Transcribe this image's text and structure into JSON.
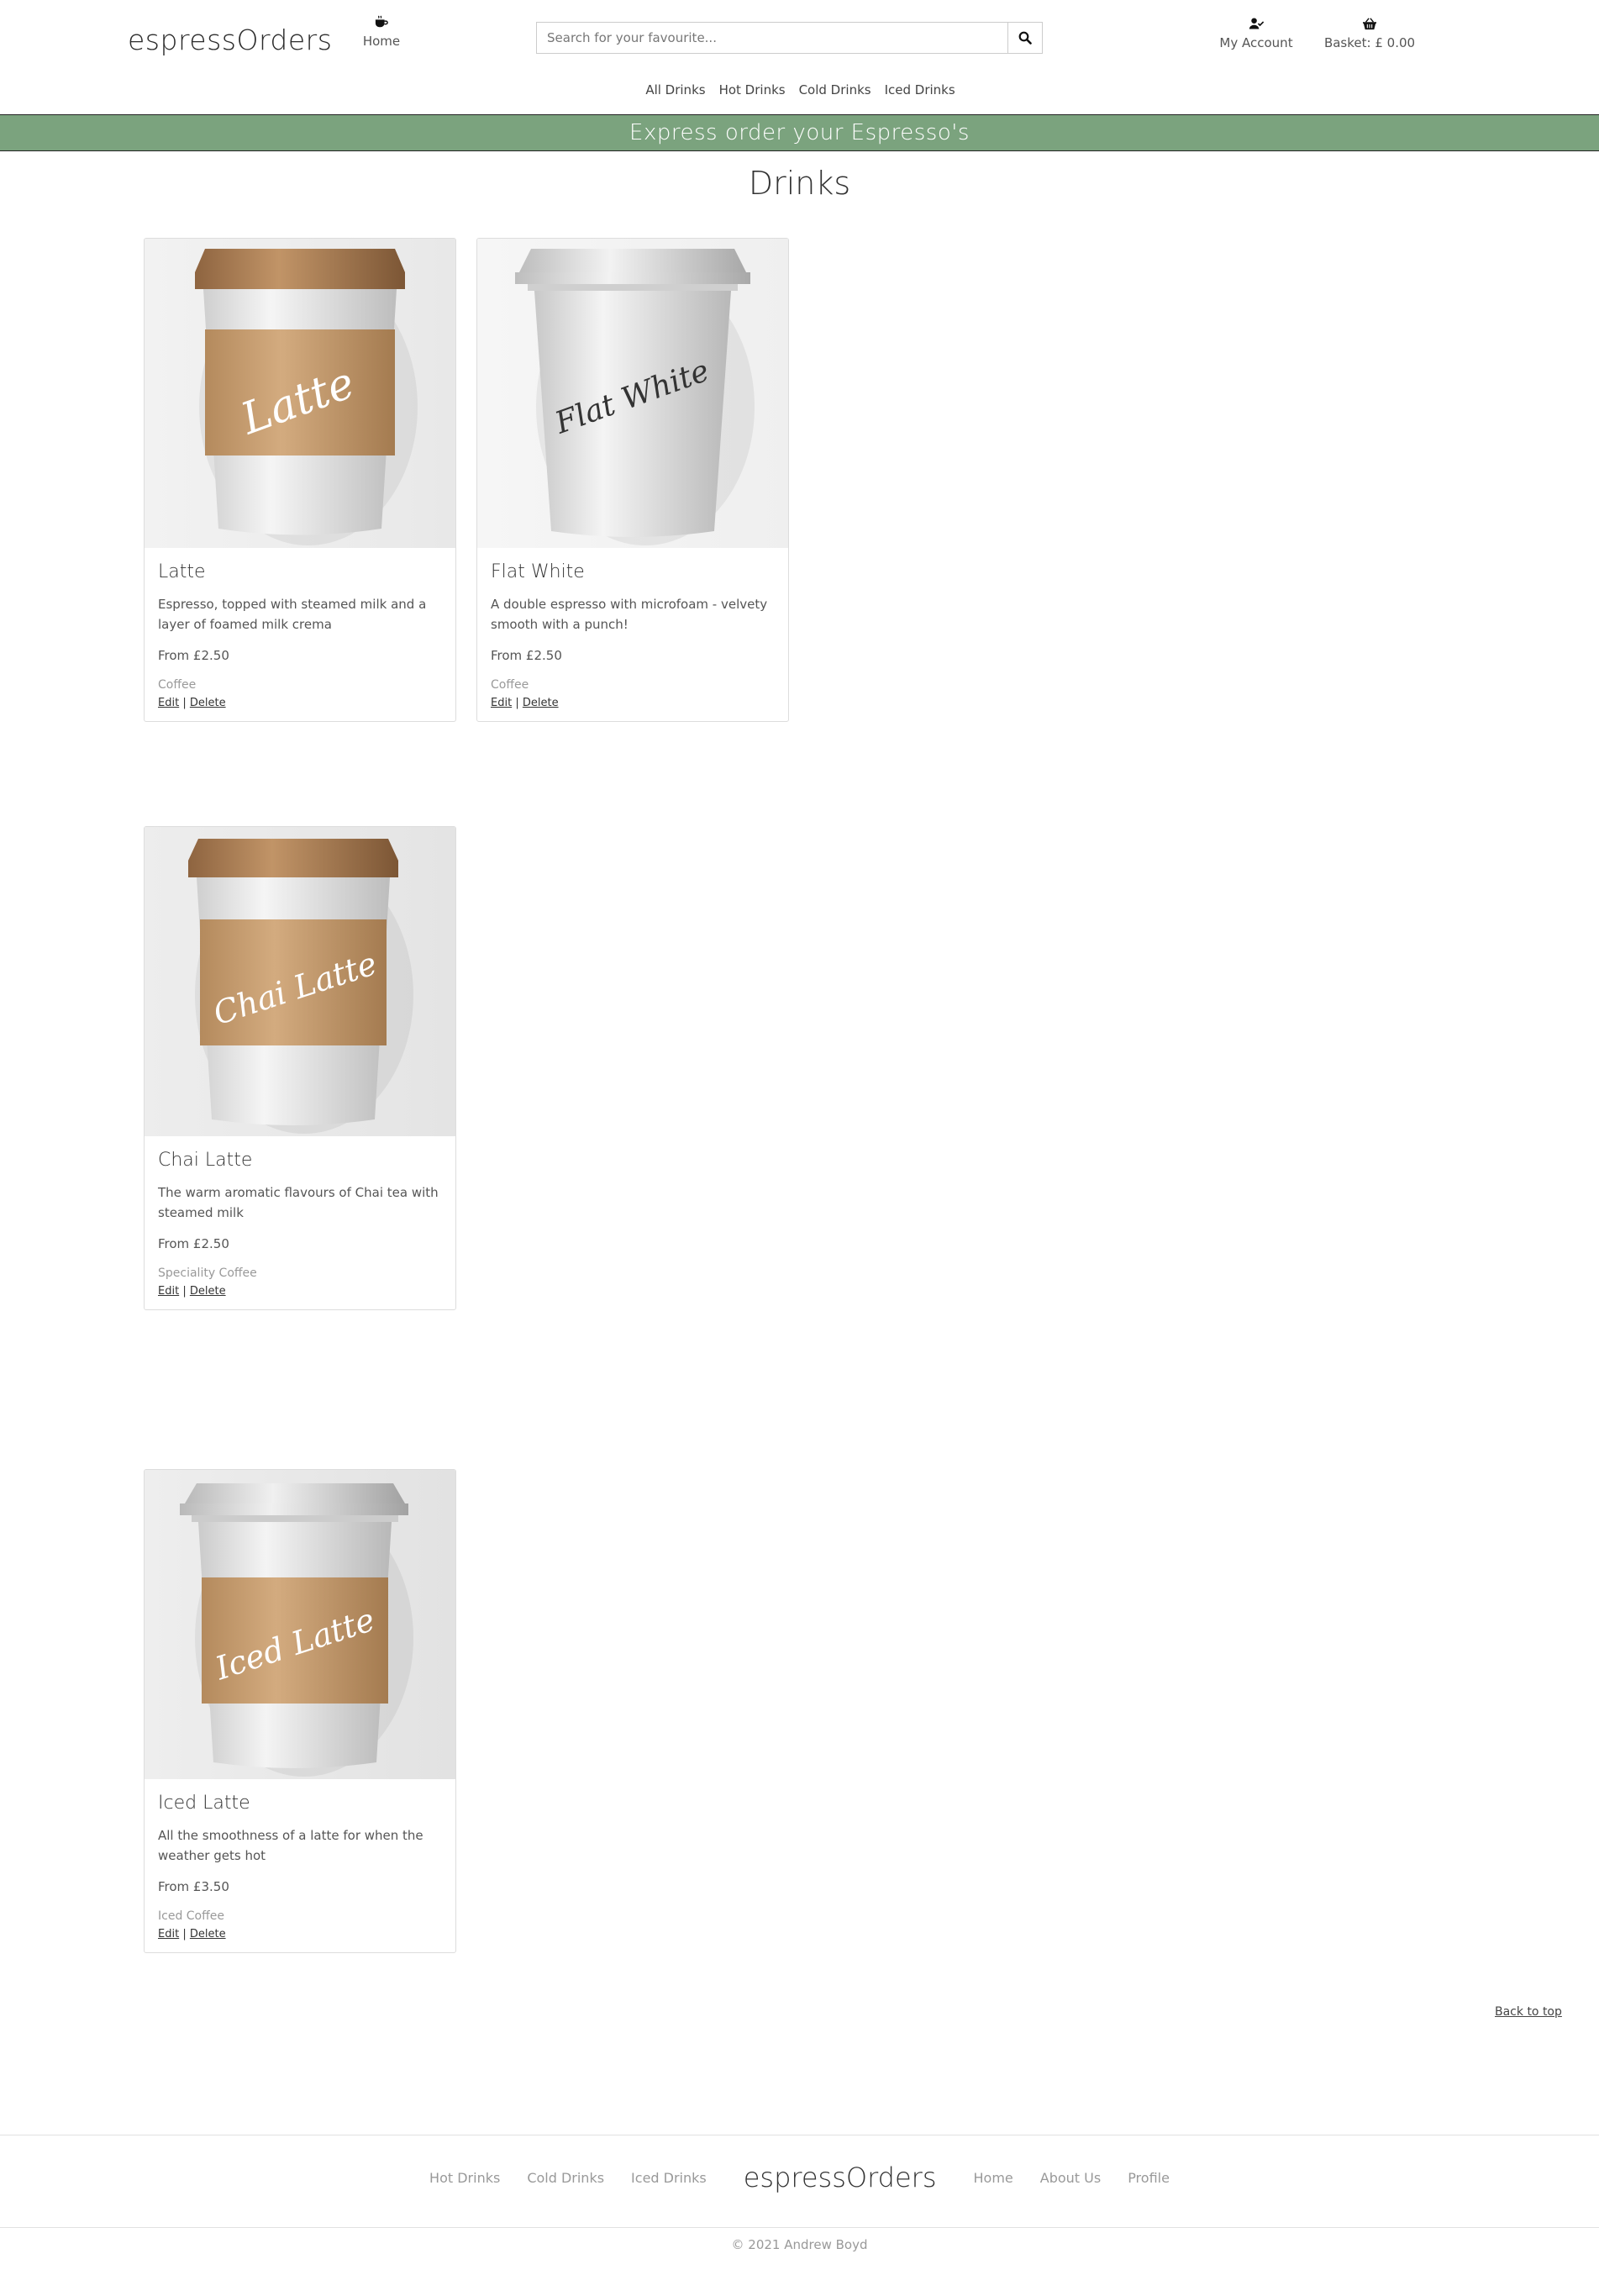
{
  "header": {
    "brand": "espressOrders",
    "home_label": "Home",
    "search_placeholder": "Search for your favourite...",
    "account_label": "My Account",
    "basket_label": "Basket: £ 0.00"
  },
  "category_nav": [
    "All Drinks",
    "Hot Drinks",
    "Cold Drinks",
    "Iced Drinks"
  ],
  "banner": "Express order your Espresso's",
  "page_title": "Drinks",
  "drinks": [
    {
      "name": "Latte",
      "cup_text": "Latte",
      "description": "Espresso, topped with steamed milk and a layer of foamed milk crema",
      "price": "From £2.50",
      "category": "Coffee",
      "edit": "Edit",
      "delete": "Delete",
      "lid_color": "#a87c53",
      "sleeve_color": "#c49a6c"
    },
    {
      "name": "Flat White",
      "cup_text": "Flat White",
      "description": "A double espresso with microfoam - velvety smooth with a punch!",
      "price": "From £2.50",
      "category": "Coffee",
      "edit": "Edit",
      "delete": "Delete",
      "lid_color": "#e0e0e0",
      "sleeve_color": "none"
    },
    {
      "name": "Chai Latte",
      "cup_text": "Chai Latte",
      "description": "The warm aromatic flavours of Chai tea with steamed milk",
      "price": "From £2.50",
      "category": "Speciality Coffee",
      "edit": "Edit",
      "delete": "Delete",
      "lid_color": "#a87c53",
      "sleeve_color": "#c49a6c"
    },
    {
      "name": "Iced Latte",
      "cup_text": "Iced Latte",
      "description": "All the smoothness of a latte for when the weather gets hot",
      "price": "From £3.50",
      "category": "Iced Coffee",
      "edit": "Edit",
      "delete": "Delete",
      "lid_color": "#d9d9d9",
      "sleeve_color": "#c49a6c"
    }
  ],
  "separator": "|",
  "back_to_top": "Back to top",
  "footer": {
    "links_left": [
      "Hot Drinks",
      "Cold Drinks",
      "Iced Drinks"
    ],
    "brand": "espressOrders",
    "links_right": [
      "Home",
      "About Us",
      "Profile"
    ],
    "copyright": "© 2021 Andrew Boyd"
  },
  "colors": {
    "banner": "#7ba37e"
  }
}
